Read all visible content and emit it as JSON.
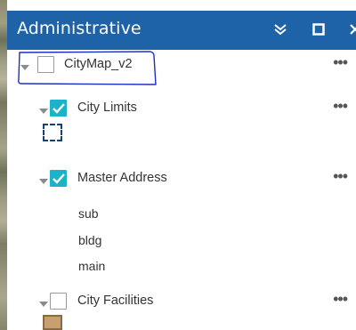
{
  "panel": {
    "title": "Administrative",
    "buttons": {
      "collapse_icon": "double-chevron-down-icon",
      "maximize_icon": "square-icon",
      "close_icon": "close-icon"
    },
    "header_color": "#1e63a8"
  },
  "layers": [
    {
      "label": "CityMap_v2",
      "checked": false,
      "more": "•••"
    },
    {
      "label": "City Limits",
      "checked": true,
      "more": "•••"
    },
    {
      "label": "Master Address",
      "checked": true,
      "more": "•••",
      "sublayers": [
        "sub",
        "bldg",
        "main"
      ]
    },
    {
      "label": "City Facilities",
      "checked": false,
      "more": "•••"
    }
  ],
  "colors": {
    "checkbox_checked": "#1cb3c9",
    "annotation_ink": "#1a2fc0"
  }
}
